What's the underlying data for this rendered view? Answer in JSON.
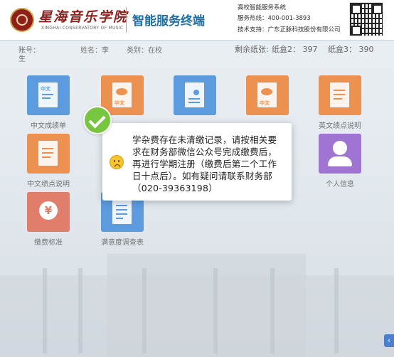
{
  "header": {
    "school_name_cn": "星海音乐学院",
    "school_name_en": "XINGHAI CONSERVATORY OF MUSIC",
    "terminal_title": "智能服务终端",
    "system_name": "高校智能服务系统",
    "hotline": "服务热线：400-001-3893",
    "tech_support": "技术支持：广东正脉科技股份有限公司"
  },
  "info_row": {
    "account_label": "账号：",
    "account_suffix": "生",
    "name_label": "姓名：李",
    "category_label": "类别：在校",
    "paper_remaining_label": "剩余纸张:",
    "paper_box2": "纸盒2：  397",
    "paper_box3": "纸盒3：  390"
  },
  "tiles": [
    {
      "label": "中文成绩单",
      "icon": "document-icon",
      "tag": "中文",
      "color": "#3a86d8"
    },
    {
      "label": "",
      "icon": "certificate-icon",
      "tag": "中文",
      "color": "#e8792a"
    },
    {
      "label": "",
      "icon": "document-person-icon",
      "tag": "",
      "color": "#3a86d8"
    },
    {
      "label": "",
      "icon": "certificate-icon",
      "tag": "中文",
      "color": "#e8792a"
    },
    {
      "label": "英文绩点说明",
      "icon": "document-icon",
      "tag": "",
      "color": "#e8792a"
    },
    {
      "label": "中文绩点说明",
      "icon": "document-icon",
      "tag": "",
      "color": "#e8792a"
    },
    {
      "label": "个人信息",
      "icon": "person-icon",
      "tag": "",
      "color": "#8c56c9"
    },
    {
      "label": "缴费标准",
      "icon": "yen-icon",
      "tag": "",
      "color": "#d9614b"
    },
    {
      "label": "满意度调查表",
      "icon": "survey-icon",
      "tag": "",
      "color": "#3a86d8"
    }
  ],
  "dialog": {
    "message": "学杂费存在未清缴记录，请按相关要求在财务部微信公众号完成缴费后，再进行学期注册（缴费后第二个工作日十点后）。如有疑问请联系财务部（020-39363198）",
    "icon": "sad-face-icon"
  },
  "badge_icon": "check-icon",
  "side_arrow": "‹"
}
